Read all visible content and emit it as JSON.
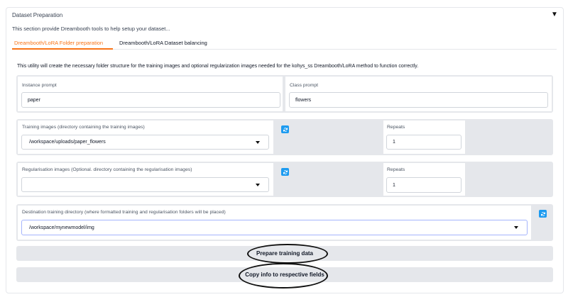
{
  "section": {
    "title": "Dataset Preparation",
    "description": "This section provide Dreambooth tools to help setup your dataset...",
    "collapse_icon": "triangle-down-icon"
  },
  "tabs": [
    {
      "label": "Dreambooth/LoRA Folder preparation",
      "active": true
    },
    {
      "label": "Dreambooth/LoRA Dataset balancing",
      "active": false
    }
  ],
  "utility_description": "This utility will create the necessary folder structure for the training images and optional regularization images needed for the kohys_ss Dreambooth/LoRA method to function correctly.",
  "instance_prompt": {
    "label": "Instance prompt",
    "value": "paper"
  },
  "class_prompt": {
    "label": "Class prompt",
    "value": "flowers"
  },
  "training_images": {
    "label": "Training images (directory containing the training images)",
    "value": "/workspace/uploads/paper_flowers",
    "repeats_label": "Repeats",
    "repeats_value": "1"
  },
  "regularisation_images": {
    "label": "Regularisation images (Optional. directory containing the regularisation images)",
    "value": "",
    "repeats_label": "Repeats",
    "repeats_value": "1"
  },
  "destination": {
    "label": "Destination training directory (where formatted training and regularisation folders will be placed)",
    "value": "/workspace/mynewmodel/img"
  },
  "buttons": {
    "prepare": "Prepare training data",
    "copy": "Copy info to respective fields"
  },
  "colors": {
    "accent": "#f97316",
    "refresh": "#1d9bf0",
    "row_bg": "#e5e7eb"
  },
  "icons": {
    "refresh": "refresh-icon",
    "dropdown": "chevron-down-icon"
  }
}
